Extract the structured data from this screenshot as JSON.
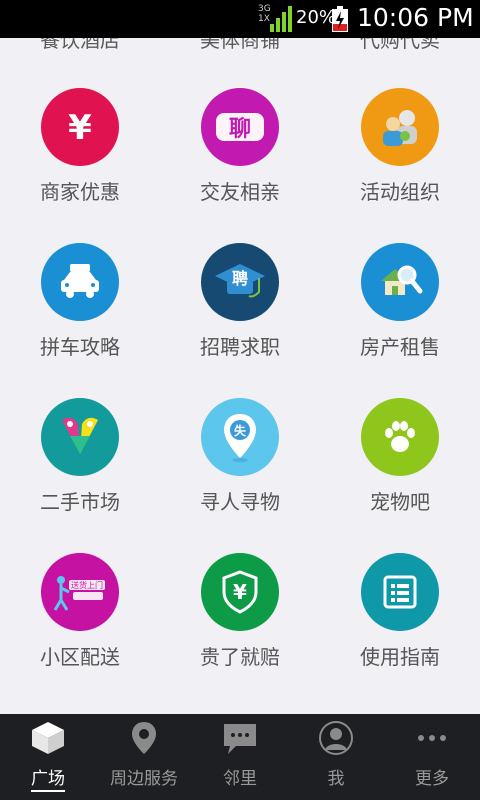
{
  "status_bar": {
    "network": "3G",
    "network2": "1X",
    "battery_percent": "20%",
    "time": "10:06 PM"
  },
  "partial_row": [
    "餐饮酒店",
    "美体商铺",
    "代购代卖"
  ],
  "grid": [
    {
      "label": "商家优惠",
      "icon": "yen-icon",
      "color": "#e0124f",
      "glyph": "¥"
    },
    {
      "label": "交友相亲",
      "icon": "chat-icon",
      "color": "#c21ab0",
      "glyph": "聊"
    },
    {
      "label": "活动组织",
      "icon": "group-icon",
      "color": "#f09a14",
      "glyph": ""
    },
    {
      "label": "拼车攻略",
      "icon": "car-icon",
      "color": "#1a8fd4",
      "glyph": ""
    },
    {
      "label": "招聘求职",
      "icon": "recruit-icon",
      "color": "#174a73",
      "glyph": "聘"
    },
    {
      "label": "房产租售",
      "icon": "house-search-icon",
      "color": "#1a8fd4",
      "glyph": ""
    },
    {
      "label": "二手市场",
      "icon": "market-icon",
      "color": "#129b9a",
      "glyph": ""
    },
    {
      "label": "寻人寻物",
      "icon": "location-pin-icon",
      "color": "#5cc6ec",
      "glyph": "失"
    },
    {
      "label": "宠物吧",
      "icon": "paw-icon",
      "color": "#8ec61b",
      "glyph": ""
    },
    {
      "label": "小区配送",
      "icon": "delivery-icon",
      "color": "#c512a3",
      "glyph": "送货上门"
    },
    {
      "label": "贵了就赔",
      "icon": "shield-yen-icon",
      "color": "#0e9b48",
      "glyph": "¥"
    },
    {
      "label": "使用指南",
      "icon": "guide-icon",
      "color": "#0f98a8",
      "glyph": ""
    }
  ],
  "nav": [
    {
      "label": "广场",
      "icon": "cube-icon",
      "active": true
    },
    {
      "label": "周边服务",
      "icon": "map-pin-icon",
      "active": false
    },
    {
      "label": "邻里",
      "icon": "chat-bubble-icon",
      "active": false
    },
    {
      "label": "我",
      "icon": "person-icon",
      "active": false
    },
    {
      "label": "更多",
      "icon": "more-dots-icon",
      "active": false
    }
  ]
}
